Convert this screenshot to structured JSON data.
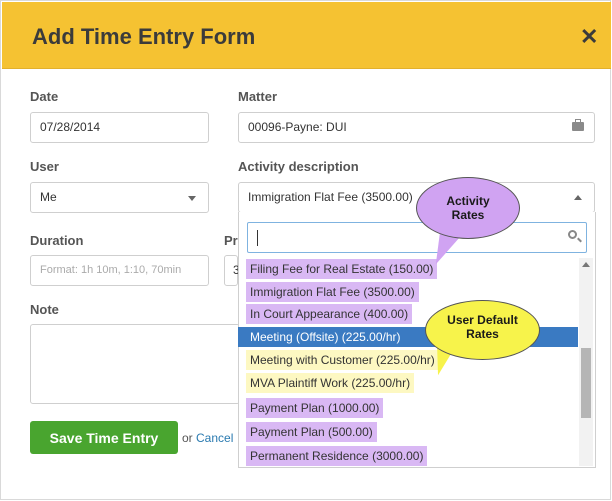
{
  "dialog": {
    "title": "Add Time Entry Form",
    "close_label": "✕"
  },
  "fields": {
    "date": {
      "label": "Date",
      "value": "07/28/2014"
    },
    "matter": {
      "label": "Matter",
      "value": "00096-Payne: DUI"
    },
    "user": {
      "label": "User",
      "value": "Me"
    },
    "activity": {
      "label": "Activity description",
      "value": "Immigration Flat Fee (3500.00)"
    },
    "duration": {
      "label": "Duration",
      "placeholder": "Format: 1h 10m, 1:10, 70min"
    },
    "price": {
      "label": "Pr",
      "value": "3"
    },
    "note": {
      "label": "Note"
    }
  },
  "dropdown": {
    "search_value": "",
    "options": [
      {
        "label": "Filing Fee for Real Estate (150.00)",
        "type": "activity"
      },
      {
        "label": "Immigration Flat Fee (3500.00)",
        "type": "activity"
      },
      {
        "label": "In Court Appearance (400.00)",
        "type": "activity"
      },
      {
        "label": "Meeting (Offsite) (225.00/hr)",
        "type": "selected"
      },
      {
        "label": "Meeting with Customer (225.00/hr)",
        "type": "user"
      },
      {
        "label": "MVA Plaintiff Work (225.00/hr)",
        "type": "user"
      },
      {
        "label": "Payment Plan (1000.00)",
        "type": "activity"
      },
      {
        "label": "Payment Plan (500.00)",
        "type": "activity"
      },
      {
        "label": "Permanent Residence (3000.00)",
        "type": "activity"
      }
    ]
  },
  "callouts": {
    "activity_rates": "Activity Rates",
    "user_default_rates": "User Default Rates"
  },
  "actions": {
    "save_label": "Save Time Entry",
    "or_label": "or",
    "cancel_label": "Cancel"
  },
  "colors": {
    "header": "#f5c232",
    "activity_highlight": "#d9b8f4",
    "user_highlight": "#fdf8c2",
    "selected": "#3a7ac2",
    "save_button": "#49a52f"
  }
}
